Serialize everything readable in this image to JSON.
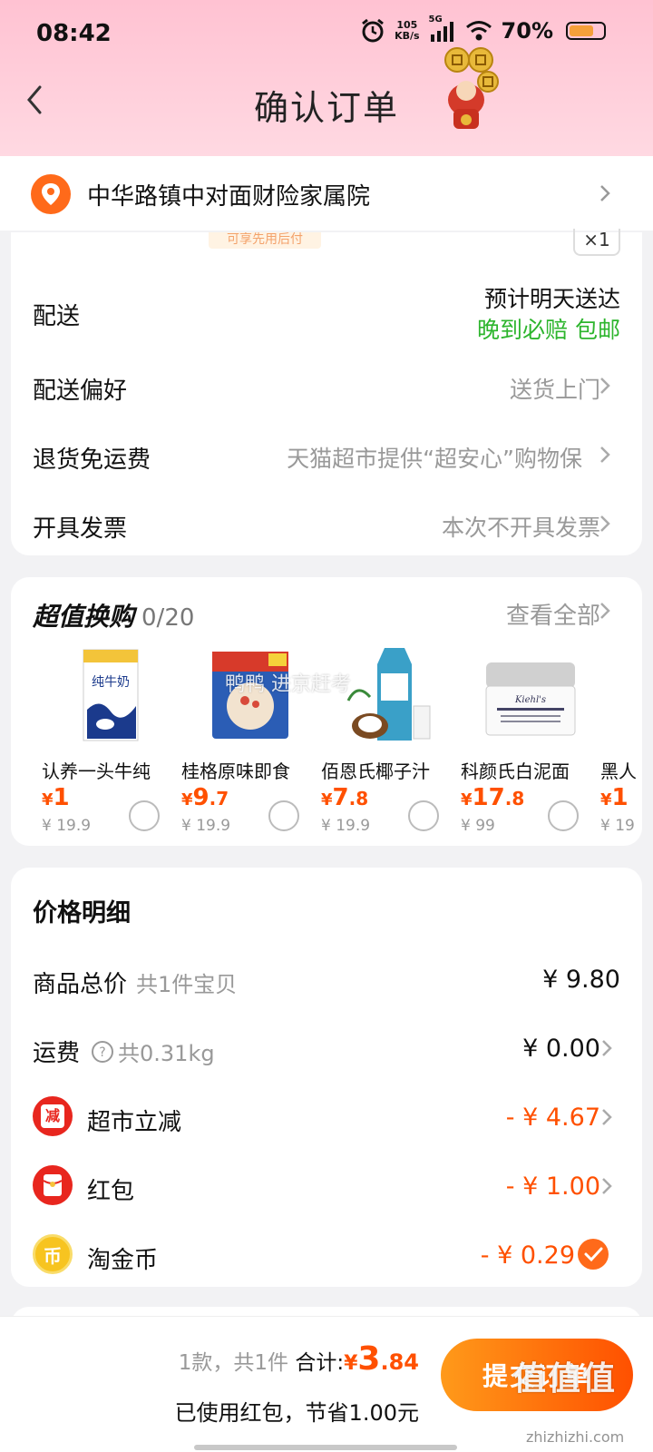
{
  "status_bar": {
    "time": "08:42",
    "net_speed_value": "105",
    "net_speed_unit": "KB/s",
    "network": "5G",
    "battery": "70%"
  },
  "nav": {
    "title": "确认订单"
  },
  "address": {
    "text": "中华路镇中对面财险家属院"
  },
  "shipping": {
    "peek_tag": "可享先用后付",
    "peek_qty": "×1",
    "delivery_label": "配送",
    "delivery_eta": "预计明天送达",
    "delivery_promise": "晚到必赔 包邮",
    "pref_label": "配送偏好",
    "pref_value": "送货上门",
    "return_label": "退货免运费",
    "return_value": "天猫超市提供“超安心”购物保",
    "invoice_label": "开具发票",
    "invoice_value": "本次不开具发票"
  },
  "deals": {
    "title": "超值换购",
    "count": "0/20",
    "view_all": "查看全部",
    "items": [
      {
        "name": "认养一头牛纯",
        "currency": "¥",
        "price_int": "1",
        "price_dec": "",
        "original": "¥ 19.9"
      },
      {
        "name": "桂格原味即食",
        "currency": "¥",
        "price_int": "9",
        "price_dec": ".7",
        "original": "¥ 19.9"
      },
      {
        "name": "佰恩氏椰子汁",
        "currency": "¥",
        "price_int": "7",
        "price_dec": ".8",
        "original": "¥ 19.9"
      },
      {
        "name": "科颜氏白泥面",
        "currency": "¥",
        "price_int": "17",
        "price_dec": ".8",
        "original": "¥ 99"
      },
      {
        "name": "黑人",
        "currency": "¥",
        "price_int": "1",
        "price_dec": "",
        "original": "¥ 19"
      }
    ],
    "overlay_text": "鸭鸭 进京赶考"
  },
  "price_detail": {
    "title": "价格明细",
    "goods_label": "商品总价",
    "goods_sub": "共1件宝贝",
    "goods_value": "¥ 9.80",
    "freight_label": "运费",
    "freight_sub": "共0.31kg",
    "freight_value": "¥ 0.00",
    "discount_label": "超市立减",
    "discount_icon_text": "减",
    "discount_value": "- ¥ 4.67",
    "redpacket_label": "红包",
    "redpacket_value": "- ¥ 1.00",
    "coin_label": "淘金币",
    "coin_icon_text": "币",
    "coin_value": "- ¥ 0.29"
  },
  "bottom": {
    "count_text": "1款，共1件",
    "total_label": "合计:",
    "total_currency": "¥",
    "total_int": "3",
    "total_dec": ".84",
    "saved_text": "已使用红包，节省1.00元",
    "submit_label": "提交订单",
    "watermark": "值值值",
    "watermark_url": "zhizhizhi.com"
  },
  "colors": {
    "accent": "#ff5000",
    "header_pink": "#ffc2d2",
    "green": "#2db52d"
  }
}
